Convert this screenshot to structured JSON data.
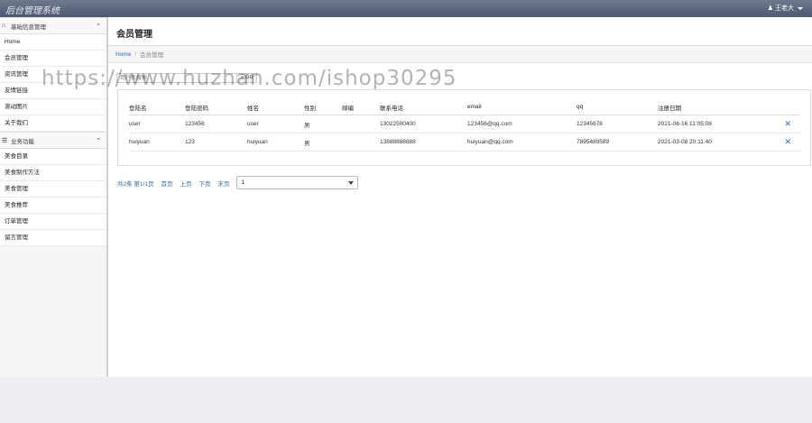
{
  "app": {
    "title": "后台管理系统",
    "user": "王老大"
  },
  "sidebar": {
    "groups": [
      {
        "label": "基础信息管理",
        "items": [
          "Home",
          "会员管理",
          "资讯管理",
          "友情链接",
          "滚动图片",
          "关于我们"
        ]
      },
      {
        "label": "业务功能",
        "items": [
          "美食目录",
          "美食制作方法",
          "美食管理",
          "美食推荐",
          "订单管理",
          "留言管理"
        ]
      }
    ]
  },
  "page": {
    "title": "会员管理",
    "breadcrumb": {
      "home": "Home",
      "current": "会员管理"
    }
  },
  "search": {
    "placeholder": "用户名搜索",
    "value": "",
    "button": "Go"
  },
  "table": {
    "headers": [
      "登陆名",
      "登陆密码",
      "姓名",
      "性别",
      "邮编",
      "联系电话",
      "email",
      "qq",
      "注册日期"
    ],
    "rows": [
      [
        "user",
        "123456",
        "user",
        "男",
        "",
        "13022500400",
        "123456@qq.com",
        "12345678",
        "2021-06-16 11:05:08"
      ],
      [
        "huiyuan",
        "123",
        "huiyuan",
        "男",
        "",
        "13888888888",
        "huiyuan@qq.com",
        "7895489589",
        "2021-03-08 20:11:40"
      ]
    ],
    "delete_icon": "✕"
  },
  "pager": {
    "summary": "共2条 第1/1页",
    "first": "首页",
    "prev": "上页",
    "next": "下页",
    "last": "末页",
    "select_value": "1"
  },
  "watermark": "https://www.huzhan.com/ishop30295",
  "colors": {
    "link": "#2a6fb5",
    "topbar": "#58637a"
  }
}
